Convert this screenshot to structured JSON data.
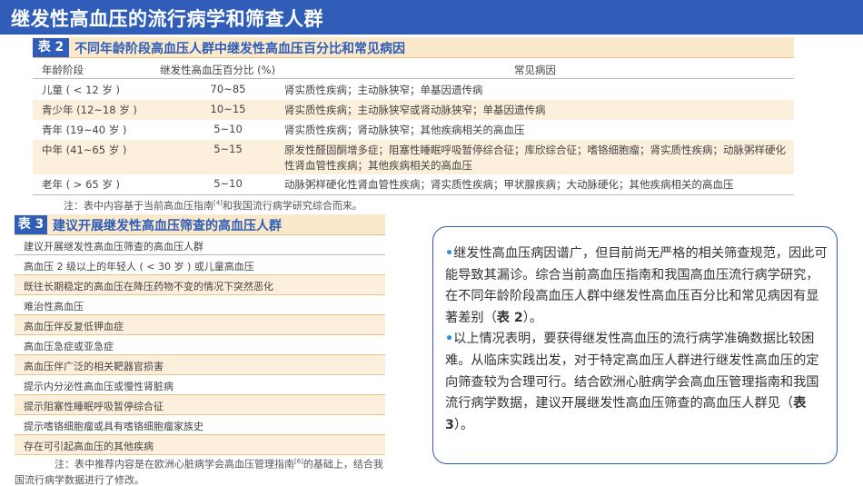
{
  "slide_title": "继发性高血压的流行病学和筛查人群",
  "table2": {
    "badge": "表 2",
    "caption": "不同年龄阶段高血压人群中继发性高血压百分比和常见病因",
    "columns": [
      "年龄阶段",
      "继发性高血压百分比 (%)",
      "常见病因"
    ],
    "rows": [
      {
        "age": "儿童 ( < 12 岁 )",
        "pct": "70~85",
        "cause": "肾实质性疾病；主动脉狭窄；单基因遗传病"
      },
      {
        "age": "青少年 (12~18 岁 )",
        "pct": "10~15",
        "cause": "肾实质性疾病；主动脉狭窄或肾动脉狭窄；单基因遗传病"
      },
      {
        "age": "青年 (19~40 岁 )",
        "pct": "5~10",
        "cause": "肾实质性疾病；肾动脉狭窄；其他疾病相关的高血压"
      },
      {
        "age": "中年 (41~65 岁 )",
        "pct": "5~15",
        "cause": "原发性醛固酮增多症；阻塞性睡眠呼吸暂停综合征；库欣综合征；嗜铬细胞瘤；肾实质性疾病；动脉粥样硬化性肾血管性疾病；其他疾病相关的高血压"
      },
      {
        "age": "老年 ( > 65 岁 )",
        "pct": "5~10",
        "cause": "动脉粥样硬化性肾血管性疾病；肾实质性疾病；甲状腺疾病；大动脉硬化；其他疾病相关的高血压"
      }
    ],
    "note_prefix": "注：表中内容基于当前高血压指南",
    "note_ref": "[4]",
    "note_suffix": "和我国流行病学研究综合而来。"
  },
  "table3": {
    "badge": "表 3",
    "caption": "建议开展继发性高血压筛查的高血压人群",
    "rows": [
      "建议开展继发性高血压筛查的高血压人群",
      "高血压 2 级以上的年轻人 ( < 30 岁 ) 或儿童高血压",
      "既往长期稳定的高血压在降压药物不变的情况下突然恶化",
      "难治性高血压",
      "高血压伴反复低钾血症",
      "高血压急症或亚急症",
      "高血压伴广泛的相关靶器官损害",
      "提示内分泌性高血压或慢性肾脏病",
      "提示阻塞性睡眠呼吸暂停综合征",
      "提示嗜铬细胞瘤或具有嗜铬细胞瘤家族史",
      "存在可引起高血压的其他疾病"
    ],
    "note_prefix": "注：表中推荐内容是在欧洲心脏病学会高血压管理指南",
    "note_ref": "[6]",
    "note_suffix": "的基础上，结合我国流行病学数据进行了修改。"
  },
  "textbox": {
    "bullet": "•",
    "p1_text": "继发性高血压病因谱广，但目前尚无严格的相关筛查规范，因此可能导致其漏诊。综合当前高血压指南和我国高血压流行病学研究，在不同年龄阶段高血压人群中继发性高血压百分比和常见病因有显著差别（",
    "p1_ref": "表 2",
    "p1_end": "）。",
    "p2_text": "以上情况表明，要获得继发性高血压的流行病学准确数据比较困难。从临床实践出发，对于特定高血压人群进行继发性高血压的定向筛查较为合理可行。结合欧洲心脏病学会高血压管理指南和我国流行病学数据，建议开展继发性高血压筛查的高血压人群见（",
    "p2_ref": "表 3",
    "p2_end": "）。"
  },
  "colors": {
    "brand_blue": "#2f5db8",
    "table_header_bg": "#fbe9cc",
    "row_shade": "#fcf0dd",
    "bullet": "#2f8fd8"
  }
}
